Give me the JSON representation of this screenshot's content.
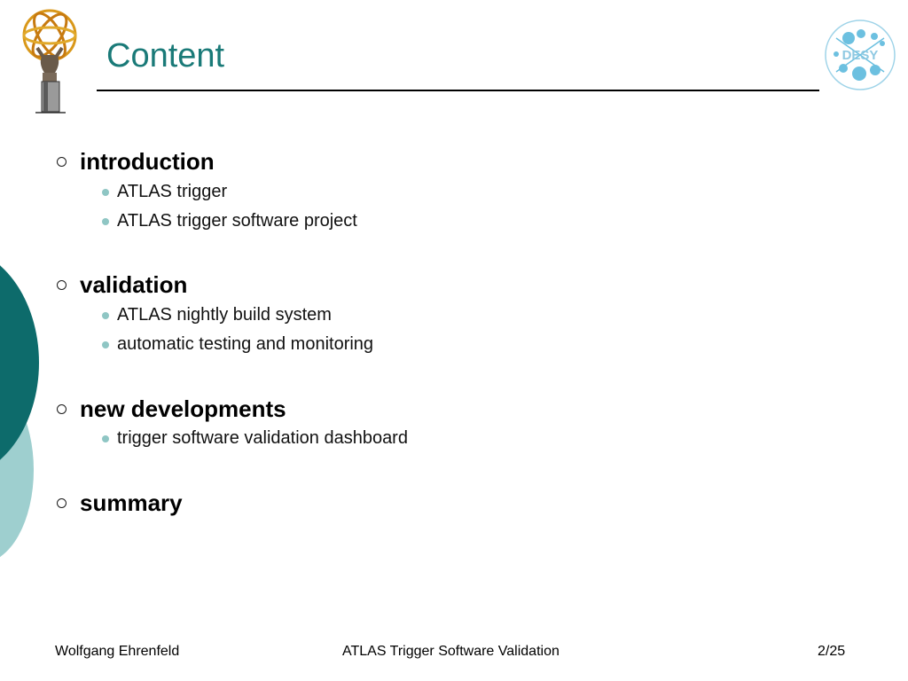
{
  "slide": {
    "title": "Content",
    "sections": [
      {
        "label": "introduction",
        "items": [
          "ATLAS trigger",
          "ATLAS trigger software project"
        ]
      },
      {
        "label": "validation",
        "items": [
          "ATLAS nightly build system",
          "automatic testing and monitoring"
        ]
      },
      {
        "label": "new developments",
        "items": [
          "trigger software validation dashboard"
        ]
      },
      {
        "label": "summary",
        "items": []
      }
    ]
  },
  "logos": {
    "left": "atlas-figure-icon",
    "right": "desy-logo",
    "right_text": "DESY"
  },
  "footer": {
    "author": "Wolfgang Ehrenfeld",
    "talk_title": "ATLAS Trigger Software Validation",
    "page": "2/25"
  },
  "colors": {
    "title": "#1a7a78",
    "accent_dark": "#0d6b6b",
    "accent_light": "#9ecfcf",
    "bullet": "#8fc6c4"
  }
}
